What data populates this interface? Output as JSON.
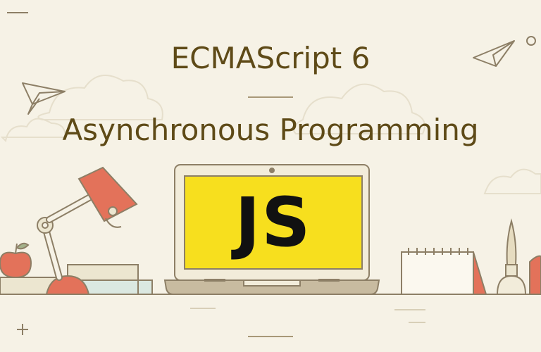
{
  "banner": {
    "title": "ECMAScript 6",
    "subtitle": "Asynchronous Programming",
    "logo_text": "JS"
  },
  "colors": {
    "background": "#f6f2e6",
    "title_text": "#5e4a17",
    "screen_yellow": "#f7df1e",
    "lamp_orange": "#e3725a",
    "outline": "#8d7f66"
  },
  "icons": [
    "paper-plane-icon",
    "cloud-icon",
    "desk-lamp-icon",
    "apple-icon",
    "book-stack-icon",
    "laptop-icon",
    "calendar-icon",
    "pen-holder-icon",
    "plus-icon"
  ]
}
